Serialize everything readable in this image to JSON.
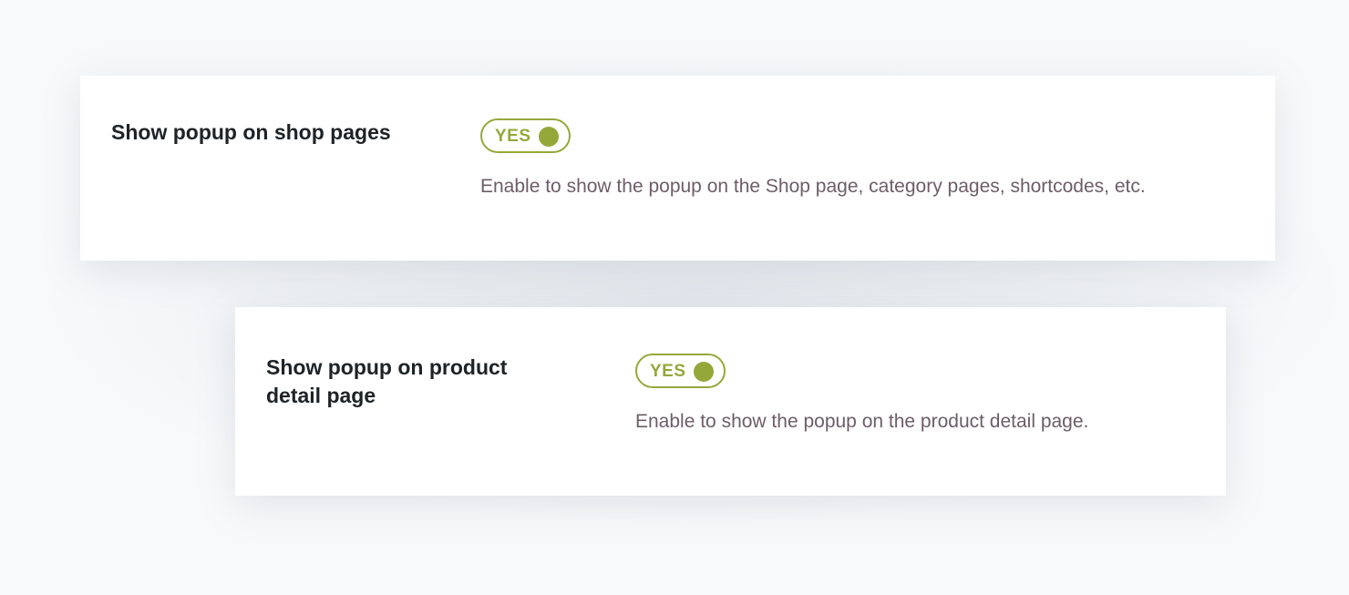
{
  "settings": [
    {
      "label": "Show popup on shop pages",
      "toggle_label": "YES",
      "enabled": true,
      "description": "Enable to show the popup on the Shop page, category pages, shortcodes, etc."
    },
    {
      "label": "Show popup on product detail page",
      "toggle_label": "YES",
      "enabled": true,
      "description": "Enable to show the popup on the product detail page."
    }
  ],
  "colors": {
    "accent": "#94a83a",
    "label_text": "#1d2327",
    "description_text": "#6d5d67",
    "card_background": "#ffffff",
    "page_background": "#f8f9fa"
  },
  "icons": {
    "toggle_knob": "toggle-knob-icon"
  }
}
